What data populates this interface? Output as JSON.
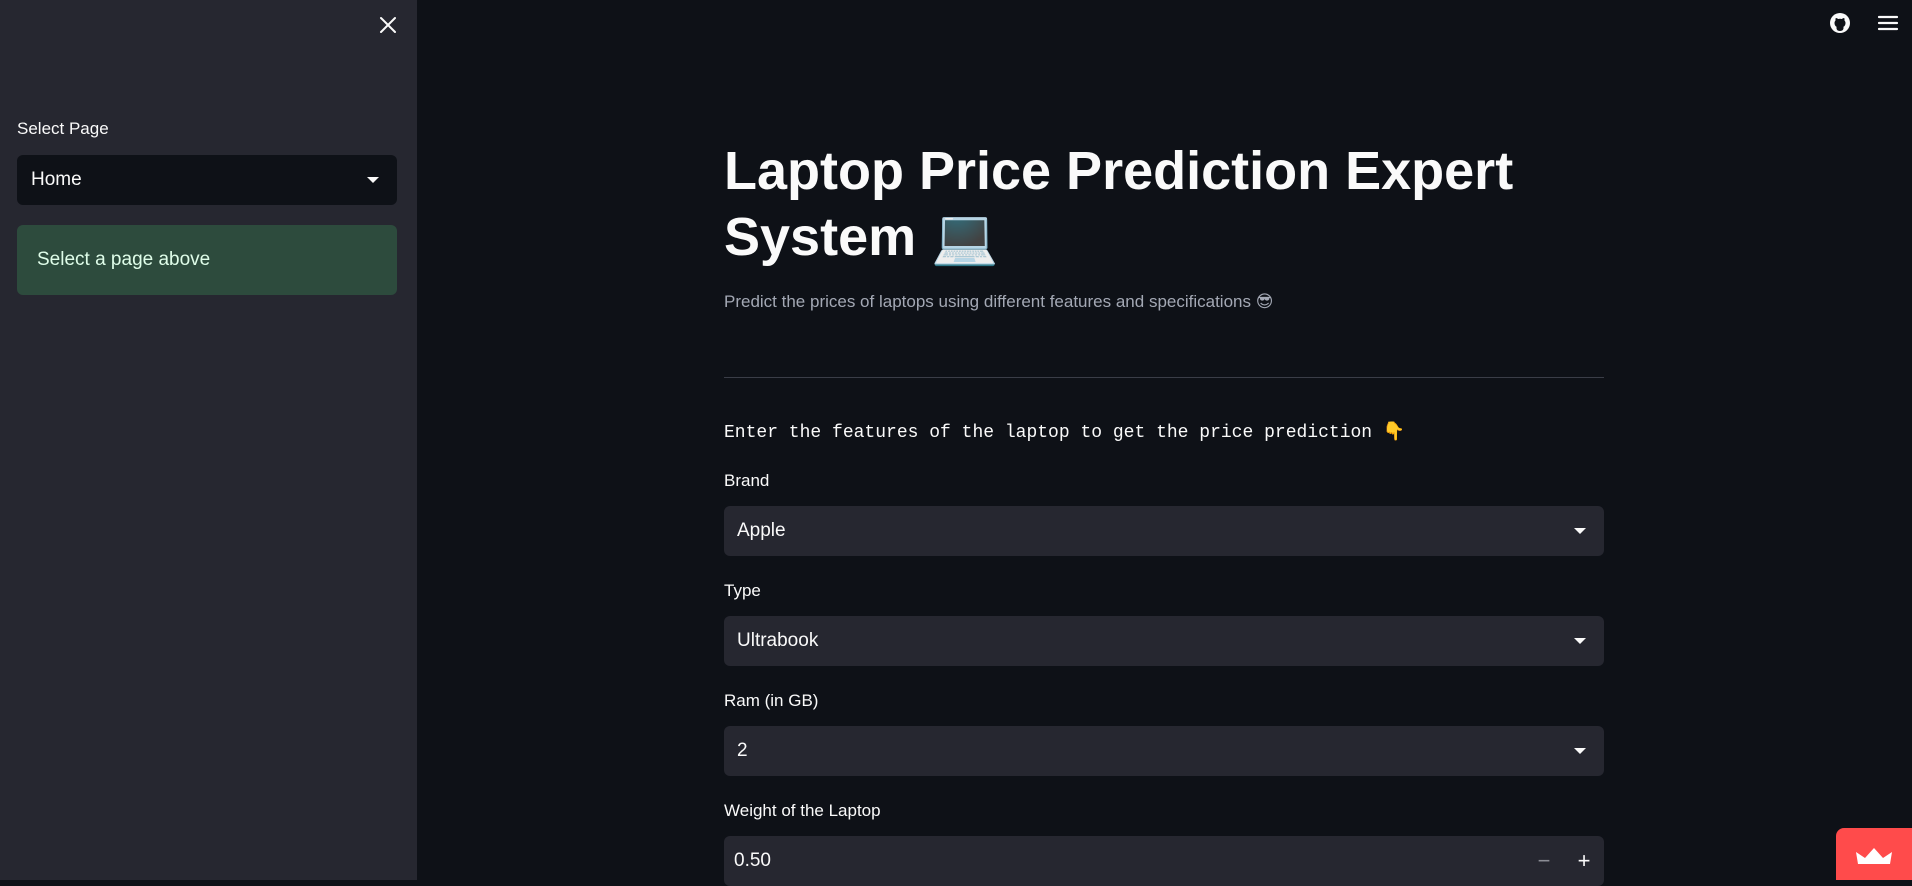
{
  "sidebar": {
    "select_label": "Select Page",
    "select_value": "Home",
    "info_text": "Select a page above"
  },
  "header": {
    "icons": [
      "github-icon",
      "hamburger-menu-icon"
    ]
  },
  "main": {
    "title_line1": "Laptop Price Prediction Expert",
    "title_line2": "System 💻",
    "subtitle": "Predict the prices of laptops using different features and specifications 😎",
    "instruction": "Enter the features of the laptop to get the price prediction 👇",
    "fields": {
      "brand": {
        "label": "Brand",
        "value": "Apple"
      },
      "type": {
        "label": "Type",
        "value": "Ultrabook"
      },
      "ram": {
        "label": "Ram (in GB)",
        "value": "2"
      },
      "weight": {
        "label": "Weight of the Laptop",
        "value": "0.50",
        "minus": "−",
        "plus": "+"
      }
    }
  },
  "colors": {
    "background": "#0e1117",
    "sidebar": "#262730",
    "info_box": "#2d4b3d",
    "accent": "#ff4b4b"
  }
}
